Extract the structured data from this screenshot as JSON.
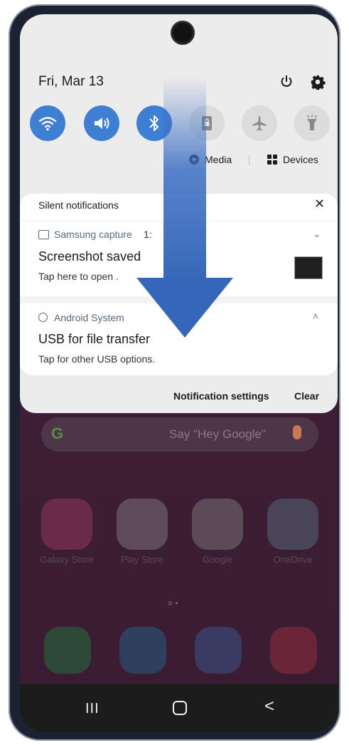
{
  "status": {
    "date": "Fri, Mar 13"
  },
  "quick_settings": {
    "toggles": [
      {
        "icon": "wifi-icon",
        "active": true
      },
      {
        "icon": "sound-icon",
        "active": true
      },
      {
        "icon": "bluetooth-icon",
        "active": true
      },
      {
        "icon": "screen-lock-icon",
        "active": false
      },
      {
        "icon": "airplane-mode-icon",
        "active": false
      },
      {
        "icon": "flashlight-icon",
        "active": false
      }
    ],
    "media_label": "Media",
    "devices_label": "Devices"
  },
  "notifications": {
    "section_title": "Silent notifications",
    "items": [
      {
        "app": "Samsung capture",
        "time": "1:",
        "title": "Screenshot saved",
        "text": "Tap here to open ."
      },
      {
        "app": "Android System",
        "title": "USB for file transfer",
        "text": "Tap for other USB options."
      }
    ],
    "settings_label": "Notification settings",
    "clear_label": "Clear"
  },
  "home": {
    "search_hint": "Say \"Hey Google\"",
    "apps": [
      {
        "label": "Galaxy Store"
      },
      {
        "label": "Play Store"
      },
      {
        "label": "Google"
      },
      {
        "label": "OneDrive"
      }
    ],
    "dock": [
      "phone-icon",
      "messages-icon",
      "internet-icon",
      "camera-icon"
    ]
  },
  "navigation": {
    "recent_label": "III",
    "back_label": "<"
  },
  "colors": {
    "accent": "#3e7ed3",
    "panel": "#ececec"
  }
}
